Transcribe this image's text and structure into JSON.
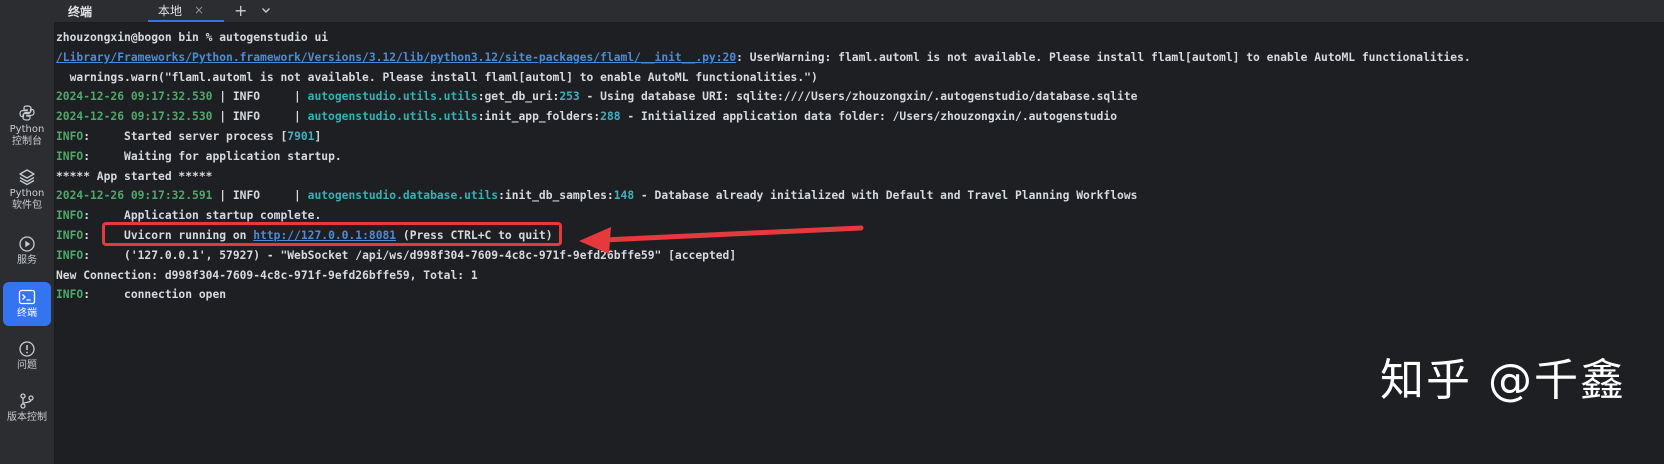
{
  "tabbar": {
    "title": "终端",
    "tab_label": "本地",
    "close_glyph": "×",
    "add_glyph": "+",
    "dropdown_icon": "chevron-down-icon"
  },
  "sidebar": {
    "items": [
      {
        "label": "Python\n控制台",
        "icon": "python-icon"
      },
      {
        "label": "Python\n软件包",
        "icon": "layers-icon"
      },
      {
        "label": "服务",
        "icon": "play-icon"
      },
      {
        "label": "终端",
        "icon": "terminal-icon",
        "active": true
      },
      {
        "label": "问题",
        "icon": "alert-icon"
      },
      {
        "label": "版本控制",
        "icon": "git-branch-icon"
      }
    ]
  },
  "terminal": {
    "lines": [
      {
        "segments": [
          {
            "text": "zhouzongxin@bogon bin % autogenstudio ui",
            "cls": ""
          }
        ]
      },
      {
        "segments": [
          {
            "text": "/Library/Frameworks/Python.framework/Versions/3.12/lib/python3.12/site-packages/flaml/__init__.py:20",
            "cls": "c-link"
          },
          {
            "text": ": UserWarning: flaml.automl is not available. Please install flaml[automl] to enable AutoML functionalities.",
            "cls": ""
          }
        ]
      },
      {
        "segments": [
          {
            "text": "  warnings.warn(\"flaml.automl is not available. Please install flaml[automl] to enable AutoML functionalities.\")",
            "cls": ""
          }
        ]
      },
      {
        "segments": [
          {
            "text": "2024-12-26 09:17:32.530",
            "cls": "c-ts"
          },
          {
            "text": " | INFO     | ",
            "cls": ""
          },
          {
            "text": "autogenstudio.utils.utils",
            "cls": "c-mod"
          },
          {
            "text": ":get_db_uri:",
            "cls": ""
          },
          {
            "text": "253",
            "cls": "c-num"
          },
          {
            "text": " - Using database URI: sqlite:////Users/zhouzongxin/.autogenstudio/database.sqlite",
            "cls": ""
          }
        ]
      },
      {
        "segments": [
          {
            "text": "2024-12-26 09:17:32.530",
            "cls": "c-ts"
          },
          {
            "text": " | INFO     | ",
            "cls": ""
          },
          {
            "text": "autogenstudio.utils.utils",
            "cls": "c-mod"
          },
          {
            "text": ":init_app_folders:",
            "cls": ""
          },
          {
            "text": "288",
            "cls": "c-num"
          },
          {
            "text": " - Initialized application data folder: /Users/zhouzongxin/.autogenstudio",
            "cls": ""
          }
        ]
      },
      {
        "segments": [
          {
            "text": "INFO",
            "cls": "c-info"
          },
          {
            "text": ":     Started server process [",
            "cls": ""
          },
          {
            "text": "7901",
            "cls": "c-num"
          },
          {
            "text": "]",
            "cls": ""
          }
        ]
      },
      {
        "segments": [
          {
            "text": "INFO",
            "cls": "c-info"
          },
          {
            "text": ":     Waiting for application startup.",
            "cls": ""
          }
        ]
      },
      {
        "segments": [
          {
            "text": "***** App started *****",
            "cls": ""
          }
        ]
      },
      {
        "segments": [
          {
            "text": "2024-12-26 09:17:32.591",
            "cls": "c-ts"
          },
          {
            "text": " | INFO     | ",
            "cls": ""
          },
          {
            "text": "autogenstudio.database.utils",
            "cls": "c-mod"
          },
          {
            "text": ":init_db_samples:",
            "cls": ""
          },
          {
            "text": "148",
            "cls": "c-num"
          },
          {
            "text": " - Database already initialized with Default and Travel Planning Workflows",
            "cls": ""
          }
        ]
      },
      {
        "segments": [
          {
            "text": "INFO",
            "cls": "c-info"
          },
          {
            "text": ":     Application startup complete.",
            "cls": ""
          }
        ]
      },
      {
        "segments": [
          {
            "text": "INFO",
            "cls": "c-info"
          },
          {
            "text": ":     Uvicorn running on ",
            "cls": ""
          },
          {
            "text": "http://127.0.0.1:8081",
            "cls": "c-url"
          },
          {
            "text": " (Press CTRL+C to quit)",
            "cls": ""
          }
        ]
      },
      {
        "segments": [
          {
            "text": "INFO",
            "cls": "c-info"
          },
          {
            "text": ":     ('127.0.0.1', 57927) - \"WebSocket /api/ws/d998f304-7609-4c8c-971f-9efd26bffe59\" [accepted]",
            "cls": ""
          }
        ]
      },
      {
        "segments": [
          {
            "text": "New Connection: d998f304-7609-4c8c-971f-9efd26bffe59, Total: 1",
            "cls": ""
          }
        ]
      },
      {
        "segments": [
          {
            "text": "INFO",
            "cls": "c-info"
          },
          {
            "text": ":     connection open",
            "cls": ""
          }
        ]
      }
    ]
  },
  "watermark": "知乎 @千鑫",
  "colors": {
    "accent": "#3574f0",
    "annotation": "#e5393e",
    "timestamp": "#4fa86a",
    "module": "#2fb4b4",
    "link": "#4c8bd8"
  }
}
